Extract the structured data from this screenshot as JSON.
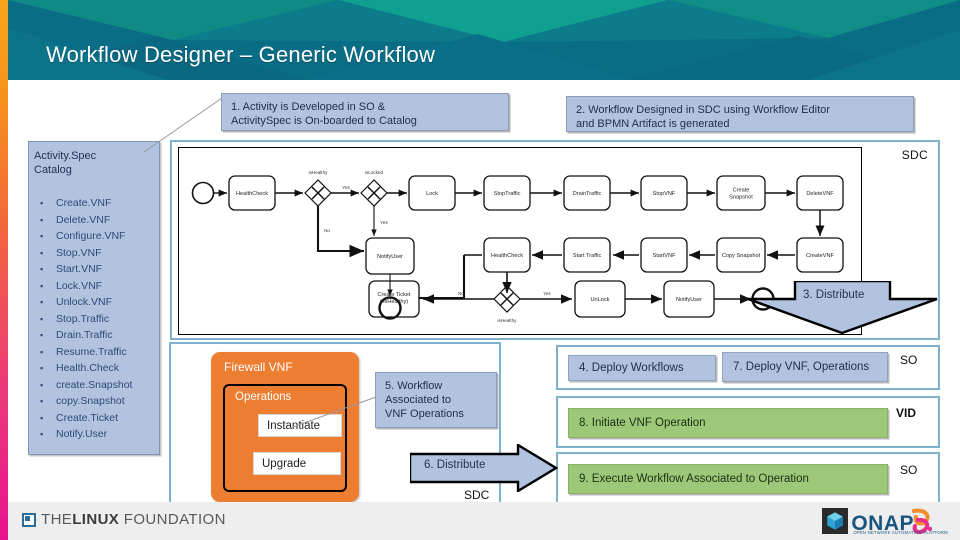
{
  "header": {
    "title": "Workflow Designer – Generic Workflow"
  },
  "callouts": {
    "step1": "1. Activity is Developed in SO &\nActivitySpec is On-boarded to Catalog",
    "step1_line1": "1. Activity is Developed in SO &",
    "step1_line2": "ActivitySpec is On-boarded to Catalog",
    "step2_line1": "2. Workflow Designed in SDC using Workflow Editor",
    "step2_line2": "and BPMN Artifact is generated",
    "step5_line1": "5. Workflow",
    "step5_line2": "Associated to",
    "step5_line3": "VNF Operations"
  },
  "catalog": {
    "title_line1": "Activity.Spec",
    "title_line2": "Catalog",
    "bullet_glyph": "▪",
    "items": [
      "Create.VNF",
      "Delete.VNF",
      "Configure.VNF",
      "Stop.VNF",
      "Start.VNF",
      "Lock.VNF",
      "Unlock.VNF",
      "Stop.Traffic",
      "Drain.Traffic",
      "Resume.Traffic",
      "Health.Check",
      "create.Snapshot",
      "copy.Snapshot",
      "Create.Ticket",
      "Notify.User"
    ]
  },
  "bpmn": {
    "panel_tag": "SDC",
    "row1": [
      "HealthCheck",
      "Lock",
      "StopTraffic",
      "DrainTraffic",
      "StopVNF",
      "Create Snapshot",
      "DeleteVNF"
    ],
    "row2": [
      "HealthCheck",
      "Start Traffic",
      "StartVNF",
      "Copy Snapshot",
      "CreateVNF"
    ],
    "row3": [
      "Create Ticket\n( is1Tisdbm)",
      "UnLock",
      "NotifyUser"
    ],
    "tasks": {
      "health_check_1": "HealthCheck",
      "lock": "Lock",
      "stop_traffic": "StopTraffic",
      "drain_traffic": "DrainTraffic",
      "stop_vnf": "StopVNF",
      "create_snapshot": "Create Snapshot",
      "delete_vnf": "DeleteVNF",
      "create_vnf": "CreateVNF",
      "copy_snapshot": "Copy Snapshot",
      "start_vnf": "StartVNF",
      "start_traffic": "Start Traffic",
      "health_check_2": "HealthCheck",
      "create_ticket": "Create Ticket",
      "create_ticket_sub": "( isHealthy)",
      "unlock": "UnLock",
      "notify_user_1": "NotifyUser",
      "notify_user_2": "NotifyUser"
    },
    "gateways": {
      "g1": "isHealthy",
      "g2": "isLocked",
      "g3": "isHealthy"
    },
    "flow_labels": {
      "yes1": "Yes",
      "no1": "No",
      "yes2": "Yes",
      "yes3": "Yes",
      "no3": "No"
    }
  },
  "distribute": {
    "step3": "3. Distribute",
    "step6": "6. Distribute"
  },
  "firewall": {
    "vnf_title": "Firewall VNF",
    "operations_title": "Operations",
    "operations": [
      "Instantiate",
      "Upgrade"
    ],
    "sdc_tag": "SDC"
  },
  "right_steps": {
    "step4": "4. Deploy Workflows",
    "step7": "7. Deploy VNF, Operations",
    "step8": "8. Initiate VNF Operation",
    "step9": "9. Execute Workflow Associated to Operation",
    "tag_so_1": "SO",
    "tag_vid": "VID",
    "tag_so_2": "SO"
  },
  "footer": {
    "lf_the": "THE",
    "lf_linux": "LINUX",
    "lf_foundation": "FOUNDATION",
    "onap_word": "ONAP",
    "onap_sub": "OPEN NETWORK AUTOMATION PLATFORM"
  },
  "colors": {
    "header_teal": "#0b6e87",
    "header_green": "#11998a",
    "callout_blue": "#b2c3e0",
    "chip_green": "#9dc87a",
    "firewall_orange": "#ED7D31",
    "panel_border": "#7fb0cc"
  }
}
